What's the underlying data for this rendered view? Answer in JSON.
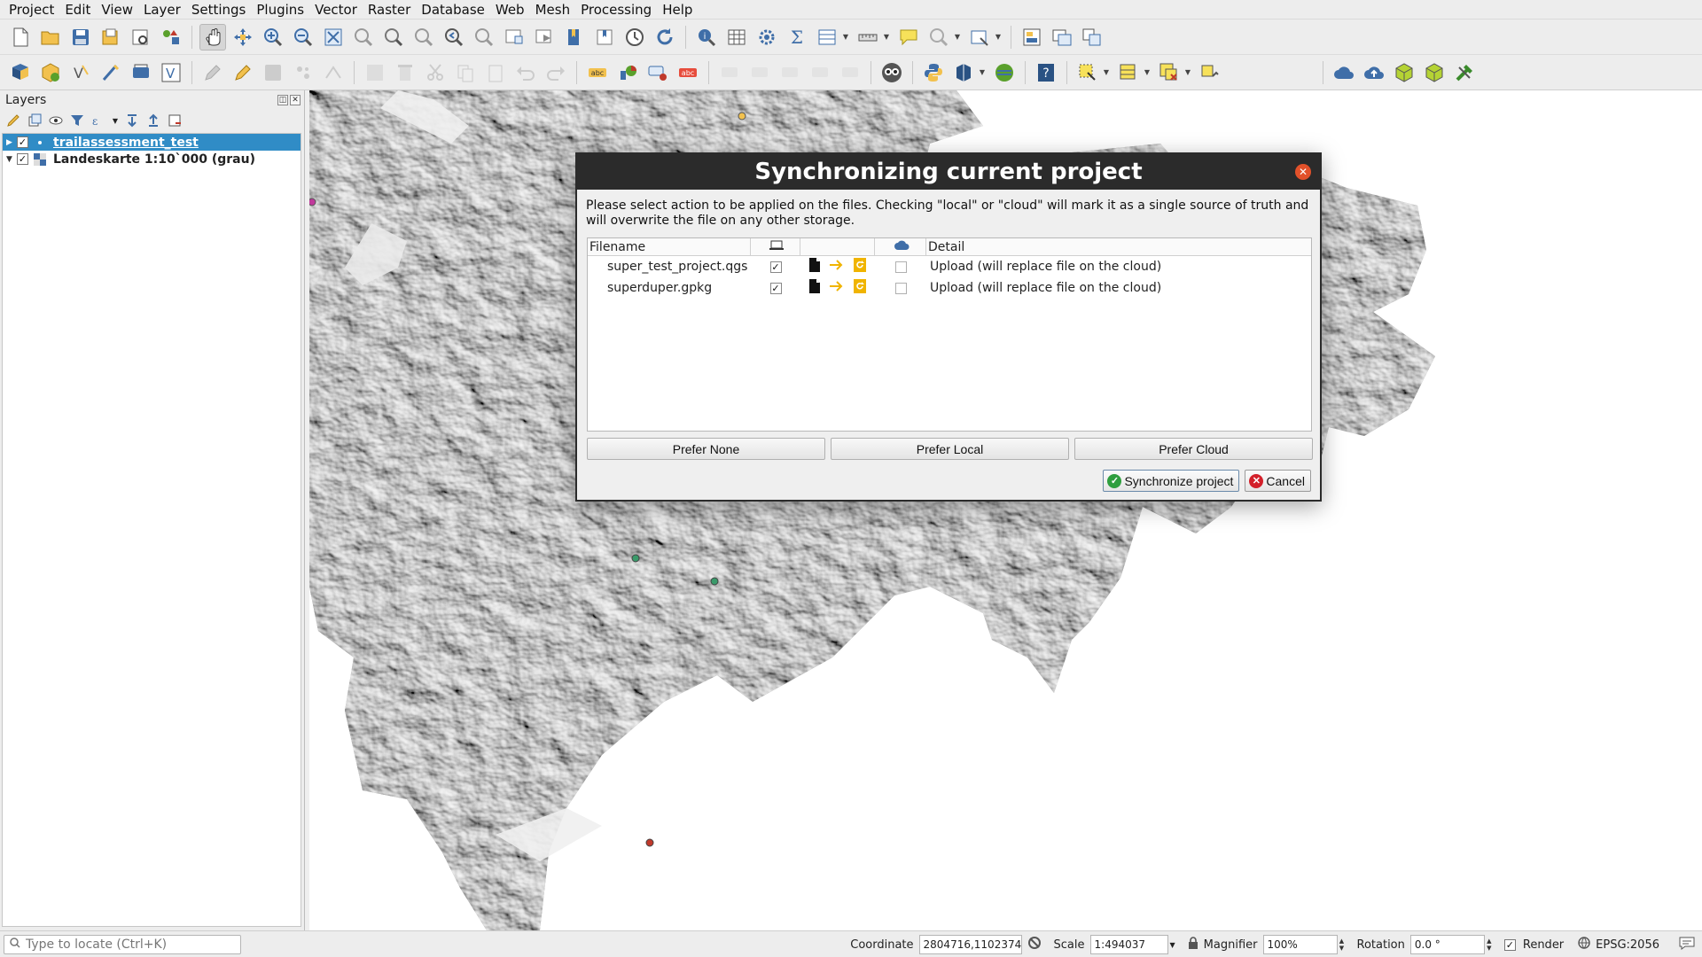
{
  "menubar": {
    "items": [
      "Project",
      "Edit",
      "View",
      "Layer",
      "Settings",
      "Plugins",
      "Vector",
      "Raster",
      "Database",
      "Web",
      "Mesh",
      "Processing",
      "Help"
    ]
  },
  "layers_panel": {
    "title": "Layers",
    "layers": [
      {
        "name": "trailassessment_test",
        "checked": true,
        "selected": true
      },
      {
        "name": "Landeskarte 1:10`000 (grau)",
        "checked": true,
        "selected": false
      }
    ]
  },
  "dialog": {
    "title": "Synchronizing current project",
    "description": "Please select action to be applied on the files. Checking \"local\" or \"cloud\" will mark it as a single source of truth and will overwrite the file on any other storage.",
    "columns": {
      "filename": "Filename",
      "detail": "Detail"
    },
    "files": [
      {
        "filename": "super_test_project.qgs",
        "local_checked": true,
        "cloud_checked": false,
        "detail": "Upload (will replace file on the cloud)"
      },
      {
        "filename": "superduper.gpkg",
        "local_checked": true,
        "cloud_checked": false,
        "detail": "Upload (will replace file on the cloud)"
      }
    ],
    "prefer_none": "Prefer None",
    "prefer_local": "Prefer Local",
    "prefer_cloud": "Prefer Cloud",
    "sync_button": "Synchronize project",
    "cancel_button": "Cancel"
  },
  "statusbar": {
    "locate_placeholder": "Type to locate (Ctrl+K)",
    "coordinate_label": "Coordinate",
    "coordinate_value": "2804716,1102374",
    "scale_label": "Scale",
    "scale_value": "1:494037",
    "magnifier_label": "Magnifier",
    "magnifier_value": "100%",
    "rotation_label": "Rotation",
    "rotation_value": "0.0 °",
    "render_label": "Render",
    "crs_label": "EPSG:2056"
  },
  "colors": {
    "selection": "#308cc6",
    "dialog_title_bg": "#2b2b2b",
    "accent_orange": "#f0b400",
    "close_red": "#e2512a"
  }
}
